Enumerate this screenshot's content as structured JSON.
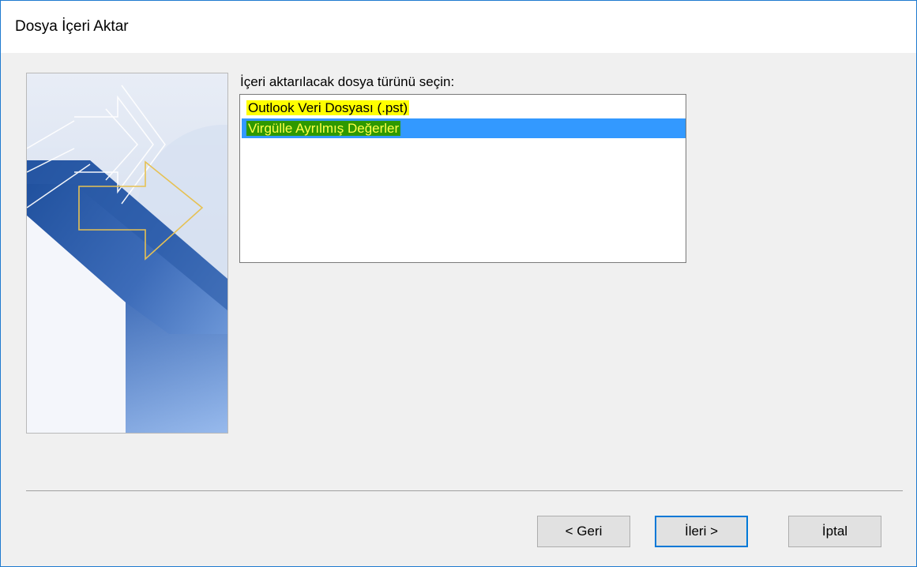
{
  "window": {
    "title": "Dosya İçeri Aktar"
  },
  "main": {
    "prompt": "İçeri aktarılacak dosya türünü seçin:",
    "file_types": [
      {
        "label": "Outlook Veri Dosyası (.pst)",
        "selected": false
      },
      {
        "label": "Virgülle Ayrılmış Değerler",
        "selected": true
      }
    ]
  },
  "buttons": {
    "back": "< Geri",
    "next": "İleri >",
    "cancel": "İptal"
  },
  "colors": {
    "selection": "#3399ff",
    "highlight_yellow": "#ffff00",
    "highlight_green": "#2e9900",
    "default_button_border": "#0078d7"
  }
}
